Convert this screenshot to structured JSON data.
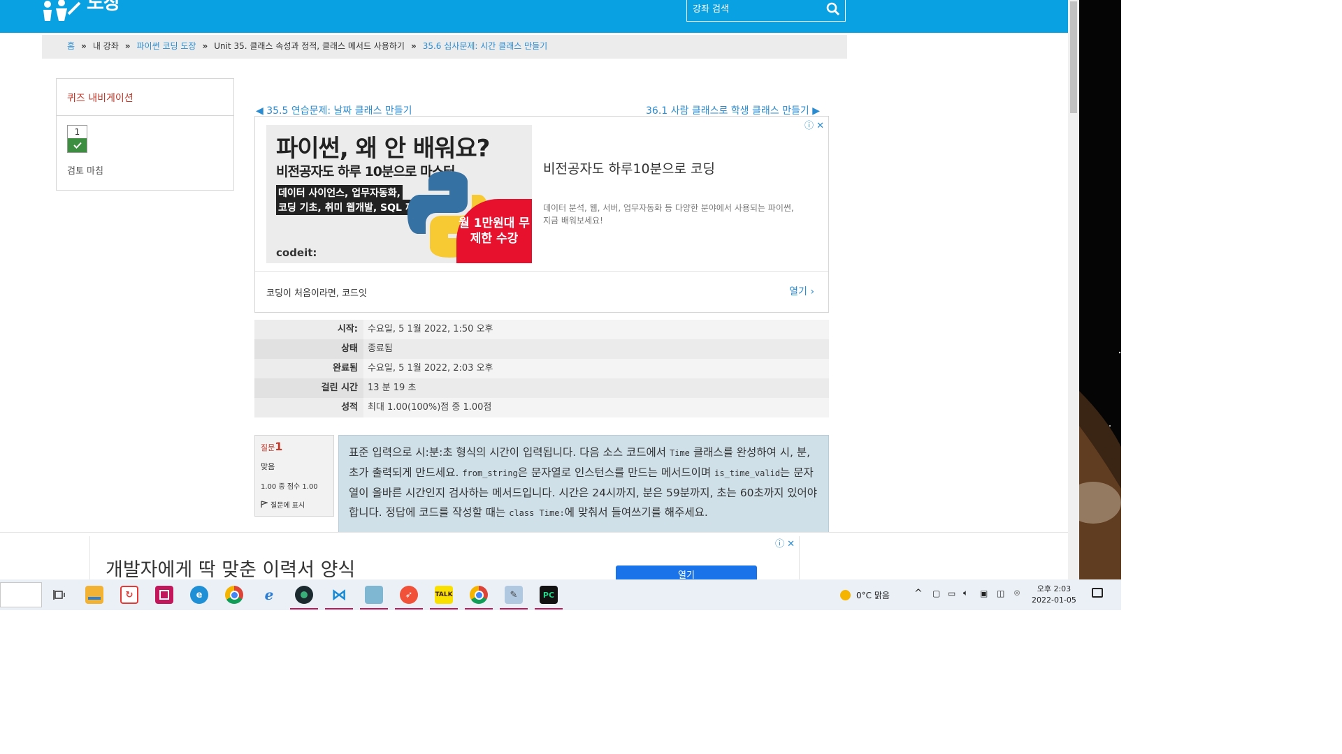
{
  "header": {
    "logo_text": "도장",
    "search_placeholder": "강좌 검색"
  },
  "breadcrumb": {
    "items": [
      "홈",
      "내 강좌",
      "파이썬 코딩 도장",
      "Unit 35. 클래스 속성과 정적, 클래스 메서드 사용하기",
      "35.6 심사문제: 시간 클래스 만들기"
    ],
    "separator": "»"
  },
  "quiz_nav": {
    "title": "퀴즈 내비게이션",
    "question_number": "1",
    "finish_review": "검토 마침"
  },
  "pager": {
    "prev": "◀ 35.5 연습문제: 날짜 클래스 만들기",
    "next": "36.1 사람 클래스로 학생 클래스 만들기 ▶"
  },
  "ad1": {
    "image_heading": "파이썬, 왜 안 배워요?",
    "image_sub": "비전공자도 하루 10분으로 마스터",
    "image_tag1": "데이터 사이언스, 업무자동화,",
    "image_tag2": "코딩 기초, 취미 웹개발, SQL 까지",
    "image_brand": "codeit:",
    "image_promo": "월 1만원대 무제한 수강",
    "title": "비전공자도 하루10분으로 코딩",
    "description": "데이터 분석, 웹, 서버, 업무자동화 등 다양한 분야에서 사용되는 파이썬, 지금 배워보세요!",
    "footer_text": "코딩이 처음이라면, 코드잇",
    "open_label": "열기",
    "close_glyph": "ⓘ ✕"
  },
  "attempt_info": [
    {
      "label": "시작:",
      "value": "수요일, 5 1월 2022, 1:50 오후"
    },
    {
      "label": "상태",
      "value": "종료됨"
    },
    {
      "label": "완료됨",
      "value": "수요일, 5 1월 2022, 2:03 오후"
    },
    {
      "label": "걸린 시간",
      "value": "13 분 19 초"
    },
    {
      "label": "성적",
      "value": "최대 1.00(100%)점 중 1.00점"
    }
  ],
  "question": {
    "label": "질문",
    "number": "1",
    "state": "맞음",
    "grade": "1.00 중 점수 1.00",
    "flag_label": "질문에 표시",
    "text_parts": {
      "t1": "표준 입력으로 시:분:초 형식의 시간이 입력됩니다. 다음 소스 코드에서 ",
      "c1": "Time",
      "t2": " 클래스를 완성하여 시, 분, 초가 출력되게 만드세요. ",
      "c2": "from_string",
      "t3": "은 문자열로 인스턴스를 만드는 메서드이며 ",
      "c3": "is_time_valid",
      "t4": "는 문자열이 올바른 시간인지 검사하는 메서드입니다. 시간은 24시까지, 분은 59분까지, 초는 60초까지 있어야 합니다. 정답에 코드를 작성할 때는 ",
      "c4": "class Time:",
      "t5": "에 맞춰서 들여쓰기를 해주세요."
    }
  },
  "bottom_ad": {
    "text": "개발자에게 딱 맞춘 이력서 양식",
    "button": "열기",
    "close_glyph": "ⓘ ✕"
  },
  "taskbar": {
    "weather": "0°C 맑음",
    "time": "오후 2:03",
    "date": "2022-01-05",
    "apps": [
      "task-view",
      "file-explorer",
      "sync-app",
      "red-app",
      "edge",
      "chrome",
      "internet-explorer",
      "green-app",
      "vscode",
      "blue-app",
      "swift-app",
      "kakaotalk",
      "chrome-2",
      "paint-app",
      "pycharm"
    ]
  }
}
